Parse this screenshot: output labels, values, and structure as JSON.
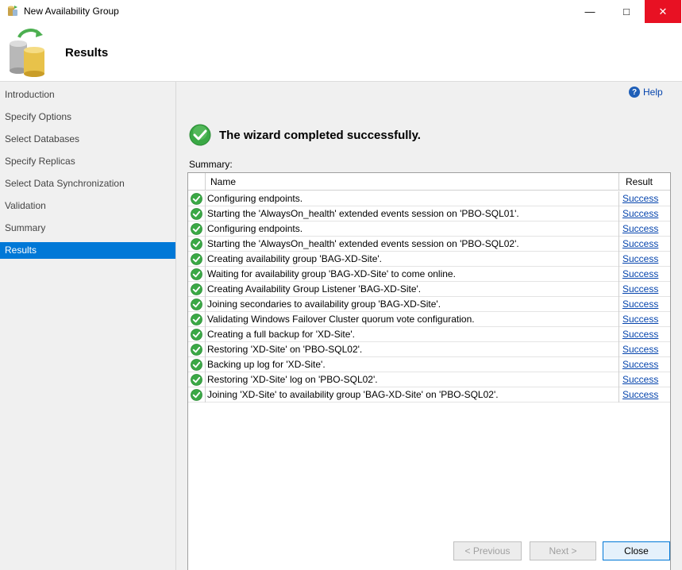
{
  "window": {
    "title": "New Availability Group",
    "minimize_glyph": "—",
    "maximize_glyph": "□",
    "close_glyph": "✕"
  },
  "header": {
    "title": "Results"
  },
  "sidebar": {
    "items": [
      {
        "label": "Introduction",
        "active": false
      },
      {
        "label": "Specify Options",
        "active": false
      },
      {
        "label": "Select Databases",
        "active": false
      },
      {
        "label": "Specify Replicas",
        "active": false
      },
      {
        "label": "Select Data Synchronization",
        "active": false
      },
      {
        "label": "Validation",
        "active": false
      },
      {
        "label": "Summary",
        "active": false
      },
      {
        "label": "Results",
        "active": true
      }
    ]
  },
  "main": {
    "help_label": "Help",
    "completion_message": "The wizard completed successfully.",
    "summary_label": "Summary:",
    "columns": {
      "name": "Name",
      "result": "Result"
    },
    "rows": [
      {
        "name": "Configuring endpoints.",
        "result": "Success"
      },
      {
        "name": "Starting the 'AlwaysOn_health' extended events session on 'PBO-SQL01'.",
        "result": "Success"
      },
      {
        "name": "Configuring endpoints.",
        "result": "Success"
      },
      {
        "name": "Starting the 'AlwaysOn_health' extended events session on 'PBO-SQL02'.",
        "result": "Success"
      },
      {
        "name": "Creating availability group 'BAG-XD-Site'.",
        "result": "Success"
      },
      {
        "name": "Waiting for availability group 'BAG-XD-Site' to come online.",
        "result": "Success"
      },
      {
        "name": "Creating Availability Group Listener 'BAG-XD-Site'.",
        "result": "Success"
      },
      {
        "name": "Joining secondaries to availability group 'BAG-XD-Site'.",
        "result": "Success"
      },
      {
        "name": "Validating Windows Failover Cluster quorum vote configuration.",
        "result": "Success"
      },
      {
        "name": "Creating a full backup for 'XD-Site'.",
        "result": "Success"
      },
      {
        "name": "Restoring 'XD-Site' on 'PBO-SQL02'.",
        "result": "Success"
      },
      {
        "name": "Backing up log for 'XD-Site'.",
        "result": "Success"
      },
      {
        "name": "Restoring 'XD-Site' log on 'PBO-SQL02'.",
        "result": "Success"
      },
      {
        "name": "Joining 'XD-Site' to availability group 'BAG-XD-Site' on 'PBO-SQL02'.",
        "result": "Success"
      }
    ]
  },
  "buttons": {
    "previous": "< Previous",
    "next": "Next >",
    "close": "Close"
  }
}
